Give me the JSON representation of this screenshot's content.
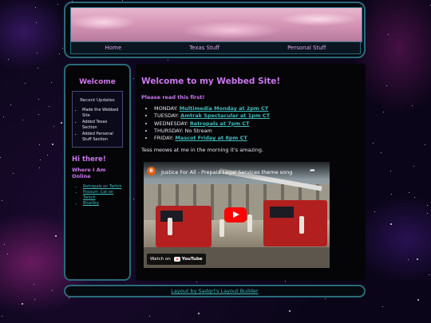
{
  "nav": {
    "items": [
      "Home",
      "Texas Stuff",
      "Personal Stuff"
    ]
  },
  "sidebar": {
    "title": "Welcome",
    "updates_title": "Recent Updates",
    "updates": [
      "Made the Webbed Site",
      "Added Texas Section",
      "Added Personal Stuff Section"
    ],
    "hi": "Hi there!",
    "where_title": "Where I Am Online",
    "links": [
      "Retropals on Twitch",
      "Possum_Cat on Twitch",
      "BlueSky"
    ]
  },
  "main": {
    "title": "Welcome to my Webbed Site!",
    "read_first": "Please read this first!",
    "schedule": [
      {
        "day": "MONDAY:",
        "link": "Multimedia Monday at 2pm CT",
        "text": ""
      },
      {
        "day": "TUESDAY:",
        "link": "Amtrak Spectacular at 1pm CT",
        "text": ""
      },
      {
        "day": "WEDNESDAY:",
        "link": "Retropals at 7pm CT",
        "text": ""
      },
      {
        "day": "THURSDAY:",
        "link": "",
        "text": "No Stream"
      },
      {
        "day": "FRIDAY:",
        "link": "Mascot Friday at 8pm CT",
        "text": ""
      }
    ],
    "tess": "Tess meows at me in the morning it's amazing."
  },
  "video": {
    "channel_initial": "B",
    "title": "Justice For All - Prepaid Legal Services theme song",
    "share_icon": "share-icon",
    "play_icon": "play-icon",
    "watch_on": "Watch on",
    "platform": "YouTube"
  },
  "footer": {
    "text": "Layout by Sadgrl's Layout Builder"
  },
  "colors": {
    "accent": "#cc77ee",
    "link": "#3fbcbc",
    "border": "#2a6b7a"
  }
}
